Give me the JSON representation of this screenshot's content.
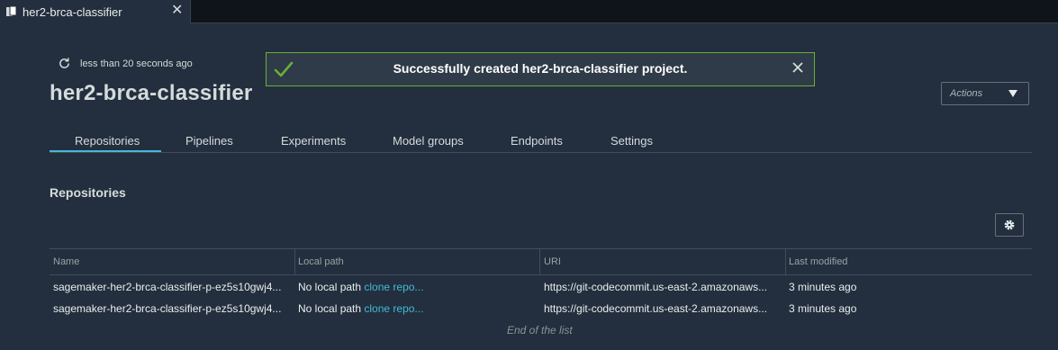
{
  "tab": {
    "title": "her2-brca-classifier"
  },
  "header": {
    "refresh_text": "less than 20 seconds ago",
    "title": "her2-brca-classifier",
    "actions_label": "Actions"
  },
  "flash": {
    "message": "Successfully created her2-brca-classifier project.",
    "color": "#6aaf35"
  },
  "nav": {
    "tabs": [
      "Repositories",
      "Pipelines",
      "Experiments",
      "Model groups",
      "Endpoints",
      "Settings"
    ],
    "active": "Repositories",
    "accent": "#44b9d6"
  },
  "section": {
    "title": "Repositories"
  },
  "table": {
    "columns": [
      "Name",
      "Local path",
      "URI",
      "Last modified"
    ],
    "rows": [
      {
        "name": "sagemaker-her2-brca-classifier-p-ez5s10gwj4...",
        "local_path": "No local path",
        "clone_link": "clone repo...",
        "uri": "https://git-codecommit.us-east-2.amazonaws...",
        "last_modified": "3 minutes ago"
      },
      {
        "name": "sagemaker-her2-brca-classifier-p-ez5s10gwj4...",
        "local_path": "No local path",
        "clone_link": "clone repo...",
        "uri": "https://git-codecommit.us-east-2.amazonaws...",
        "last_modified": "3 minutes ago"
      }
    ],
    "end_text": "End of the list"
  }
}
